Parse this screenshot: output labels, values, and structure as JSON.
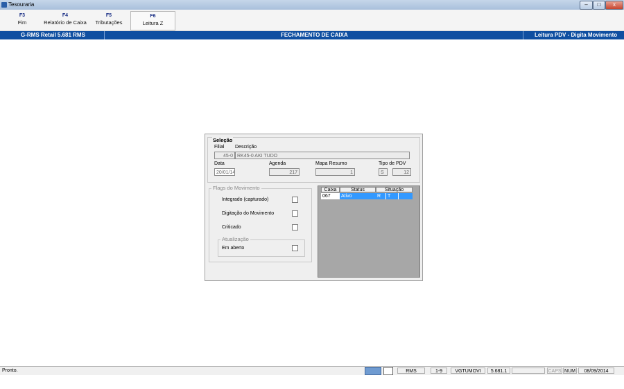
{
  "window": {
    "title": "Tesouraria",
    "minimize": "–",
    "maximize": "□",
    "close": "x"
  },
  "fkeys": [
    {
      "key": "F3",
      "label": "Fim"
    },
    {
      "key": "F4",
      "label": "Relatório de Caixa"
    },
    {
      "key": "F5",
      "label": "Tributações"
    },
    {
      "key": "F6",
      "label": "Leitura Z"
    }
  ],
  "header": {
    "left": "G-RMS Retail 5.681 RMS",
    "center": "FECHAMENTO DE CAIXA",
    "right": "Leitura PDV - Digita Movimento"
  },
  "selecao": {
    "title": "Seleção",
    "filial_label": "Filial",
    "descricao_label": "Descrição",
    "filial_value": "45-0",
    "descricao_value": "RK45-0 AKI TUDO",
    "data_label": "Data",
    "data_value": "20/01/14",
    "agenda_label": "Agenda",
    "agenda_value": "217",
    "mapa_label": "Mapa Resumo",
    "mapa_value": "1",
    "tipo_label": "Tipo de PDV",
    "tipo_value1": "S",
    "tipo_value2": "12"
  },
  "flags": {
    "title": "Flags do Movimento",
    "integrado": "Integrado (capturado)",
    "digitacao": "Digitação do Movimento",
    "criticado": "Criticado",
    "atualizacao_title": "Atualização",
    "em_aberto": "Em aberto"
  },
  "grid": {
    "columns": [
      "Caixa",
      "Status",
      "Situação"
    ],
    "rows": [
      {
        "caixa": "067",
        "status": "Ativo",
        "sit1": "R",
        "sit2": "T"
      }
    ]
  },
  "status": {
    "text": "Pronto.",
    "rms": "RMS",
    "range": "1-9",
    "program": "VGTUMOVI",
    "version": "5.681.1",
    "caps": "CAPS",
    "num": "NUM",
    "date": "08/09/2014"
  },
  "colors": {
    "header": "#0f4fa1",
    "selection": "#3399ff",
    "accent_key": "#1a2f86"
  }
}
